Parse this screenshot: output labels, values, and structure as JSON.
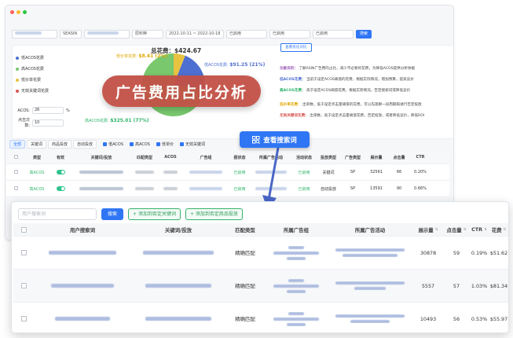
{
  "colors": {
    "blue": "#2f76f5",
    "green": "#2fc48d",
    "banner": "#c35146",
    "pie_blue": "#4d6fd1",
    "pie_green": "#79c86e",
    "pie_yellow": "#e7c341",
    "pie_red": "#d9534f",
    "dot_red": "#fe5f57",
    "dot_yellow": "#febc2e",
    "dot_green": "#28c840"
  },
  "filters": {
    "asin_label": "SEASIN",
    "product_select": "原料种",
    "date_range": "2022-10-11 ~ 2022-10-18",
    "status_1": "已启用",
    "status_2": "已启用",
    "status_3": "已启用",
    "search_btn": "搜索"
  },
  "summary": {
    "total_label": "总花费：$424.67",
    "low_acos_label": "低ACOS花费:",
    "low_acos_value": "$91.25 (21%)",
    "high_acos_label": "高ACOS花费:",
    "high_acos_value": "$325.01 (77%)",
    "low_spend_label": "低价单花费:",
    "low_spend_value": "$8.41 (2%)",
    "optimize_btn": "查看优化对比"
  },
  "legend": [
    {
      "label": "低ACOS花费",
      "color": "#4d6fd1"
    },
    {
      "label": "高ACOS花费",
      "color": "#79c86e"
    },
    {
      "label": "低价单花费",
      "color": "#e7c341"
    },
    {
      "label": "无效关键词花费",
      "color": "#d9534f"
    }
  ],
  "settings": {
    "acos_label": "ACOS:",
    "acos_value": "26",
    "acos_unit": "%",
    "clicks_label": "点击次数:",
    "clicks_value": "10"
  },
  "descriptions": [
    {
      "title": "功能目的：",
      "text": "了解ASIN广告费的占比，减少不必要的花费，为降低ACOS提供分析依据",
      "color": "#9b59b6"
    },
    {
      "title": "低ACOS花费：",
      "text": "当前于设定ACOS阈值的花费，根据实际情况，增加预算，提高竞价",
      "color": "#4d6fd1"
    },
    {
      "title": "高ACOS花费：",
      "text": "高于设定ACOS阈值花费，根据实际情况，否定搜索词或降低竞价",
      "color": "#2fb36b"
    },
    {
      "title": "低价单花费：",
      "text": "出单数，低于设定点击量阈值的花费，可以先观察一段周期再进行否定投放",
      "color": "#e0a800"
    },
    {
      "title": "无效关键词花费：",
      "text": "出单数，高于设定点击量阈值花费，否定投放，或者降低竞价，降低ROI",
      "color": "#d9534f"
    }
  ],
  "banner": "广告费用占比分析",
  "callout": "查看搜索词",
  "tabs": {
    "items": [
      "全部",
      "关键词",
      "商品投放",
      "自动投放"
    ],
    "checks": [
      "低ACOS",
      "高ACOS",
      "低单价",
      "无效关键词"
    ]
  },
  "table1": {
    "headers": [
      "类型",
      "有效",
      "关键词/投放",
      "匹配类型",
      "ACOS",
      "广告组",
      "报状态",
      "所属广告活动",
      "活动状态",
      "投放类型",
      "广告类型",
      "展示量",
      "点击量",
      "CTR"
    ],
    "rows": [
      {
        "type": "高ACOS",
        "status": "已启用",
        "status2": "已启用",
        "match": "关键词",
        "ad_type": "SP",
        "impr": "32561",
        "clicks": "66",
        "ctr": "0.20%"
      },
      {
        "type": "高ACOS",
        "status": "已启用",
        "status2": "已启用",
        "match": "自动投放",
        "ad_type": "SP",
        "impr": "13591",
        "clicks": "90",
        "ctr": "0.66%"
      }
    ]
  },
  "search": {
    "placeholder": "用户搜索词",
    "button": "搜索",
    "add_negative_kw": "添加到否定关键词",
    "add_negative_product": "添加到否定商品投放"
  },
  "table2": {
    "headers": [
      "用户搜索词",
      "关键词/投放",
      "匹配类型",
      "所属广告组",
      "所属广告活动",
      "展示量",
      "点击量",
      "CTR",
      "花费"
    ],
    "rows": [
      {
        "match": "精确匹配",
        "impr": "30878",
        "clicks": "59",
        "ctr": "0.19%",
        "cost": "$51.62"
      },
      {
        "match": "精确匹配",
        "impr": "5557",
        "clicks": "57",
        "ctr": "1.03%",
        "cost": "$81.34"
      },
      {
        "match": "精确匹配",
        "impr": "10493",
        "clicks": "56",
        "ctr": "0.53%",
        "cost": "$55.97"
      }
    ]
  }
}
